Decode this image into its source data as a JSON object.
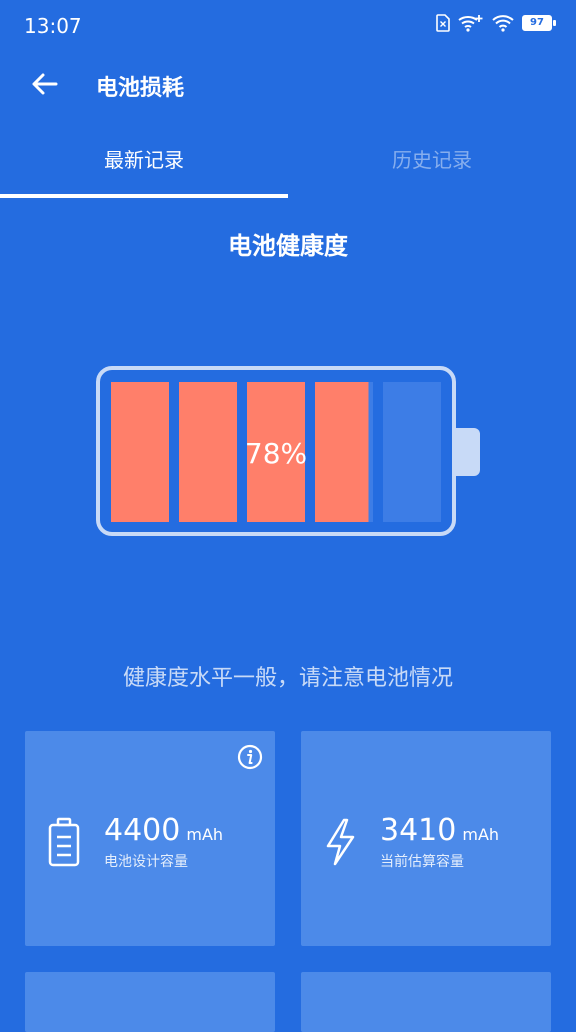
{
  "status_bar": {
    "time": "13:07",
    "battery_level": "97"
  },
  "app_bar": {
    "title": "电池损耗"
  },
  "tabs": [
    {
      "label": "最新记录",
      "active": true
    },
    {
      "label": "历史记录",
      "active": false
    }
  ],
  "battery": {
    "section_title": "电池健康度",
    "percent_text": "78%",
    "health_fraction": 0.78,
    "fill_color": "#ff7f6a",
    "message": "健康度水平一般，请注意电池情况"
  },
  "cards": [
    {
      "value": "4400",
      "unit": "mAh",
      "label": "电池设计容量",
      "icon": "battery-outline-icon"
    },
    {
      "value": "3410",
      "unit": "mAh",
      "label": "当前估算容量",
      "icon": "lightning-icon"
    }
  ],
  "colors": {
    "background": "#246ce0",
    "card": "#4c8ae9",
    "accent": "#ff7f6a"
  }
}
